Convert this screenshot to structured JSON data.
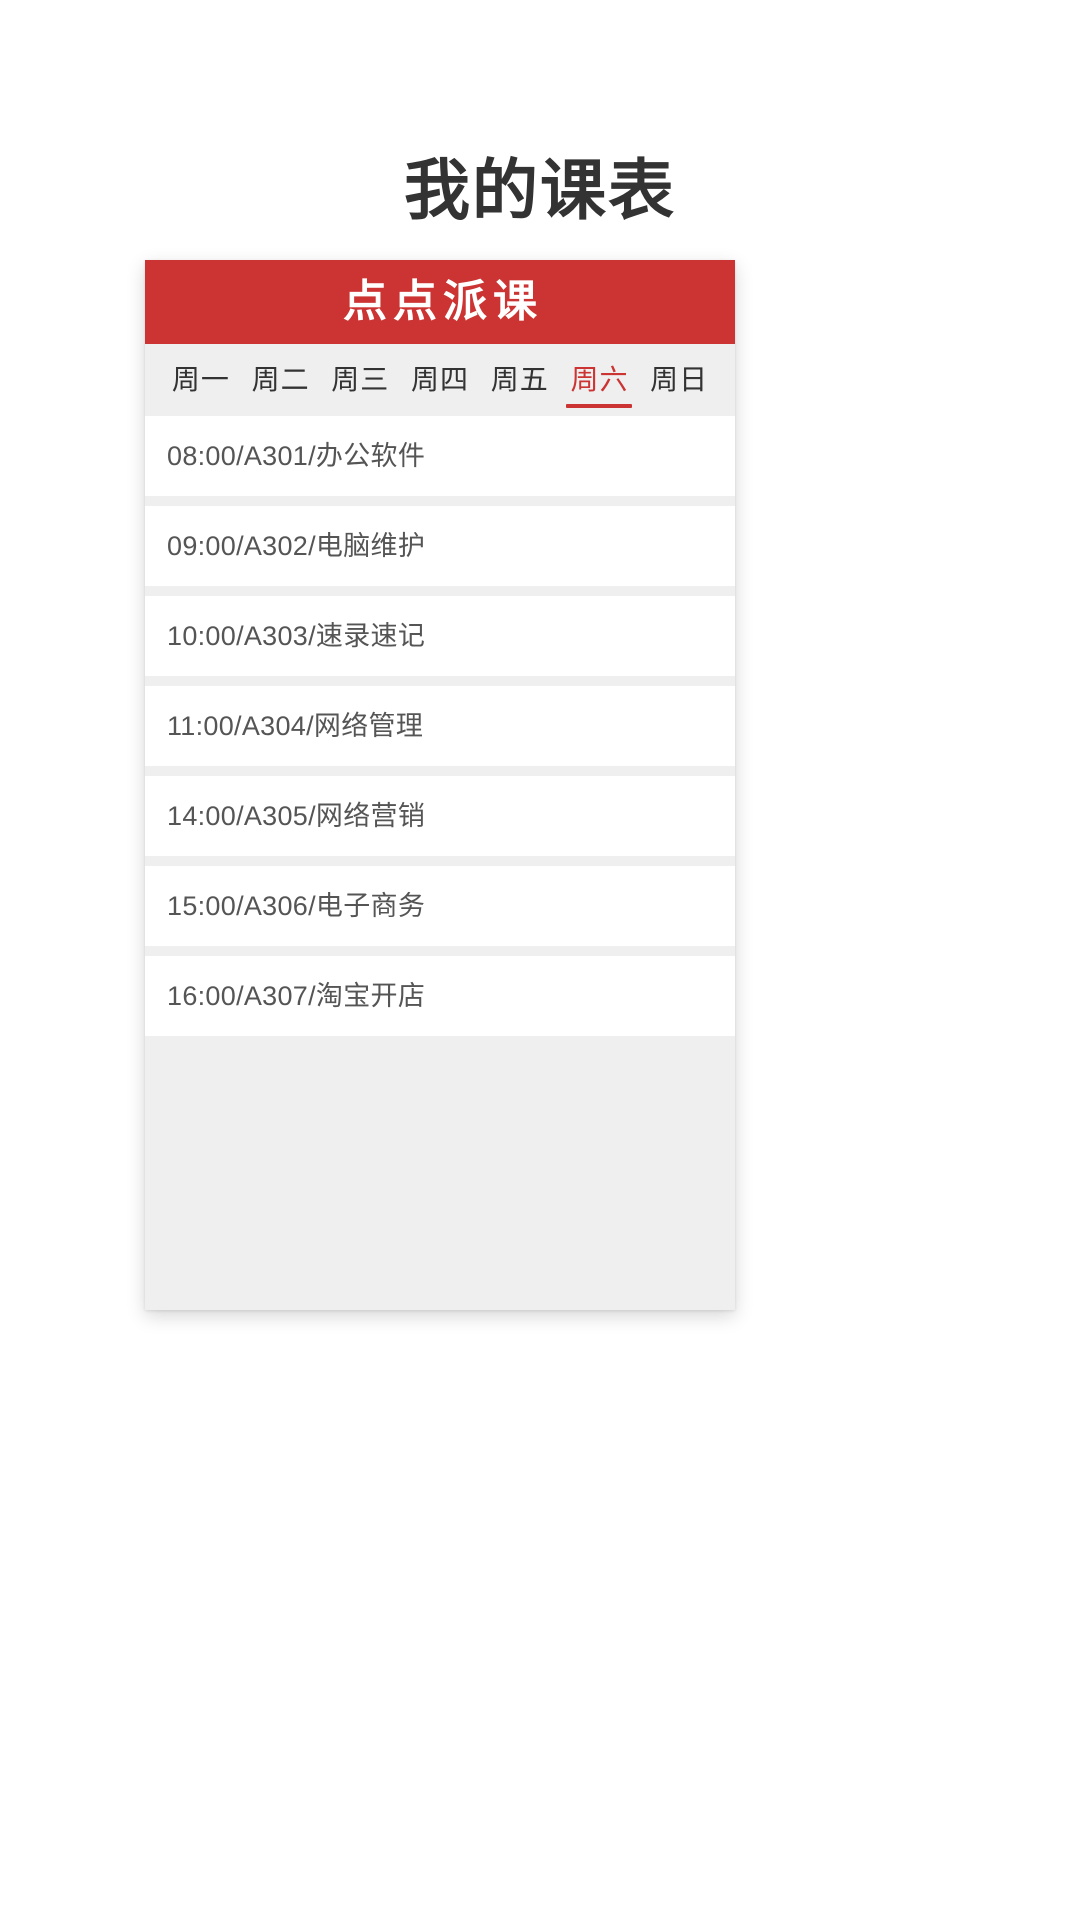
{
  "page": {
    "title": "我的课表"
  },
  "card": {
    "brand": {
      "name": "点点派课"
    },
    "accent_color": "#CC3333",
    "surface_color": "#EFEFEF",
    "row_color": "#FFFFFF",
    "text_color": "#555555",
    "tabs": [
      {
        "label": "周一",
        "active": false
      },
      {
        "label": "周二",
        "active": false
      },
      {
        "label": "周三",
        "active": false
      },
      {
        "label": "周四",
        "active": false
      },
      {
        "label": "周五",
        "active": false
      },
      {
        "label": "周六",
        "active": true
      },
      {
        "label": "周日",
        "active": false
      }
    ],
    "selected_tab": "周六",
    "courses": [
      {
        "text": "08:00/A301/办公软件",
        "time": "08:00",
        "room": "A301",
        "name": "办公软件"
      },
      {
        "text": "09:00/A302/电脑维护",
        "time": "09:00",
        "room": "A302",
        "name": "电脑维护"
      },
      {
        "text": "10:00/A303/速录速记",
        "time": "10:00",
        "room": "A303",
        "name": "速录速记"
      },
      {
        "text": "11:00/A304/网络管理",
        "time": "11:00",
        "room": "A304",
        "name": "网络管理"
      },
      {
        "text": "14:00/A305/网络营销",
        "time": "14:00",
        "room": "A305",
        "name": "网络营销"
      },
      {
        "text": "15:00/A306/电子商务",
        "time": "15:00",
        "room": "A306",
        "name": "电子商务"
      },
      {
        "text": "16:00/A307/淘宝开店",
        "time": "16:00",
        "room": "A307",
        "name": "淘宝开店"
      }
    ]
  }
}
